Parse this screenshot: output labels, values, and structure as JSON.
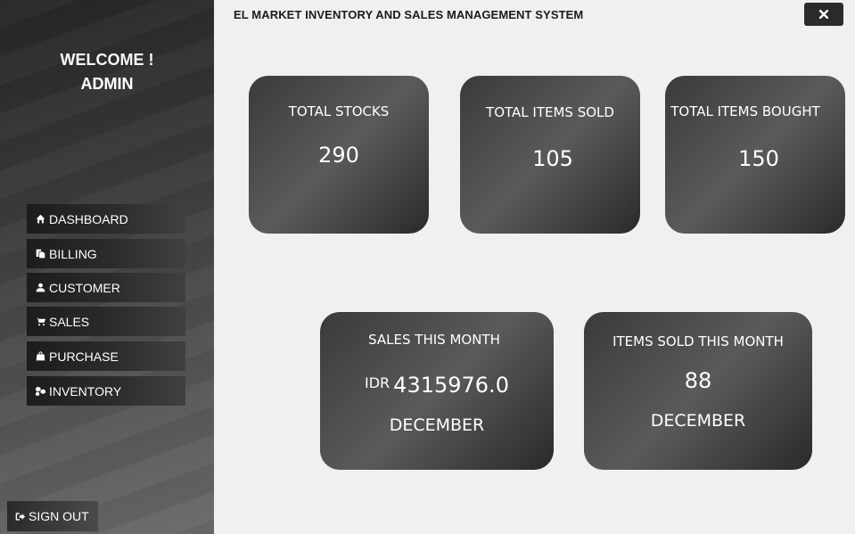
{
  "app": {
    "title": "EL MARKET INVENTORY AND SALES MANAGEMENT SYSTEM"
  },
  "sidebar": {
    "welcome_line1": "WELCOME !",
    "welcome_line2": "ADMIN",
    "items": [
      {
        "label": "DASHBOARD",
        "icon": "home-icon"
      },
      {
        "label": "BILLING",
        "icon": "copy-icon"
      },
      {
        "label": "CUSTOMER",
        "icon": "user-icon"
      },
      {
        "label": "SALES",
        "icon": "cart-icon"
      },
      {
        "label": "PURCHASE",
        "icon": "bag-icon"
      },
      {
        "label": "INVENTORY",
        "icon": "cubes-icon"
      }
    ],
    "signout_label": "SIGN OUT"
  },
  "cards": {
    "total_stocks": {
      "label": "TOTAL STOCKS",
      "value": "290"
    },
    "total_items_sold": {
      "label": "TOTAL ITEMS SOLD",
      "value": "105"
    },
    "total_items_bought": {
      "label": "TOTAL ITEMS BOUGHT",
      "value": "150"
    },
    "sales_this_month": {
      "label": "SALES THIS MONTH",
      "currency": "IDR",
      "value": "4315976.0",
      "month": "DECEMBER"
    },
    "items_sold_this_month": {
      "label": "ITEMS SOLD THIS MONTH",
      "value": "88",
      "month": "DECEMBER"
    }
  },
  "colors": {
    "sidebar_dark": "#262626",
    "card_dark": "#3a3a3a",
    "background": "#f0f0f0"
  }
}
